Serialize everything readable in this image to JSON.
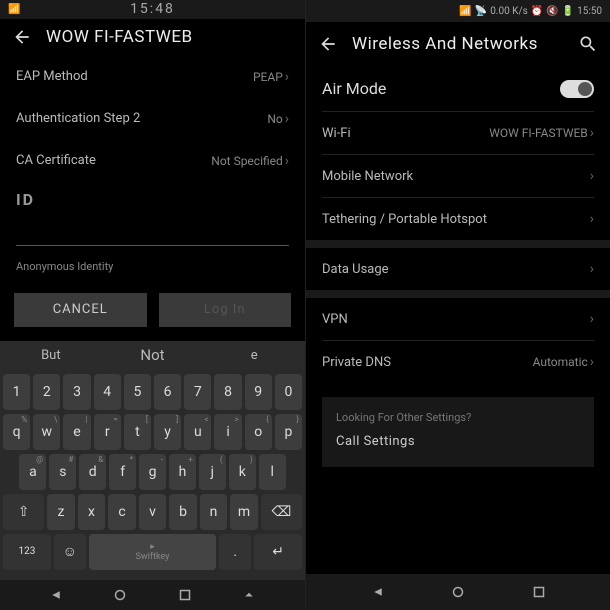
{
  "left": {
    "status": {
      "time": "15:48"
    },
    "header": {
      "title": "WOW FI-FASTWEB"
    },
    "rows": {
      "eap": {
        "label": "EAP Method",
        "value": "PEAP"
      },
      "auth": {
        "label": "Authentication Step 2",
        "value": "No"
      },
      "ca": {
        "label": "CA Certificate",
        "value": "Not Specified"
      }
    },
    "id_label": "ID",
    "anon": "Anonymous Identity",
    "buttons": {
      "cancel": "CANCEL",
      "login": "Log In"
    },
    "suggest": {
      "s1": "But",
      "s2": "Not",
      "s3": "e"
    },
    "row1": [
      "1",
      "2",
      "3",
      "4",
      "5",
      "6",
      "7",
      "8",
      "9",
      "0"
    ],
    "row2": [
      "q",
      "w",
      "e",
      "r",
      "t",
      "y",
      "u",
      "i",
      "o",
      "p"
    ],
    "hints2": [
      "%",
      "\\",
      "|",
      "=",
      "[",
      "]",
      "<",
      ">",
      "{",
      "}"
    ],
    "row3": [
      "a",
      "s",
      "d",
      "f",
      "g",
      "h",
      "j",
      "k",
      "l"
    ],
    "hints3": [
      "@",
      "#",
      "&",
      "*",
      "-",
      "+",
      "(",
      ")",
      ""
    ],
    "row4": [
      "z",
      "x",
      "c",
      "v",
      "b",
      "n",
      "m"
    ],
    "space": "Swiftkey",
    "numkey": "123"
  },
  "right": {
    "status": {
      "speed": "0.00 K/s",
      "time": "15:50"
    },
    "header": {
      "title": "Wireless And Networks"
    },
    "rows": {
      "air": {
        "label": "Air Mode"
      },
      "wifi": {
        "label": "Wi-Fi",
        "value": "WOW FI-FASTWEB"
      },
      "mobile": {
        "label": "Mobile Network"
      },
      "tether": {
        "label": "Tethering / Portable Hotspot"
      },
      "data": {
        "label": "Data Usage"
      },
      "vpn": {
        "label": "VPN"
      },
      "dns": {
        "label": "Private DNS",
        "value": "Automatic"
      }
    },
    "box": {
      "q": "Looking For Other Settings?",
      "a": "Call Settings"
    }
  }
}
